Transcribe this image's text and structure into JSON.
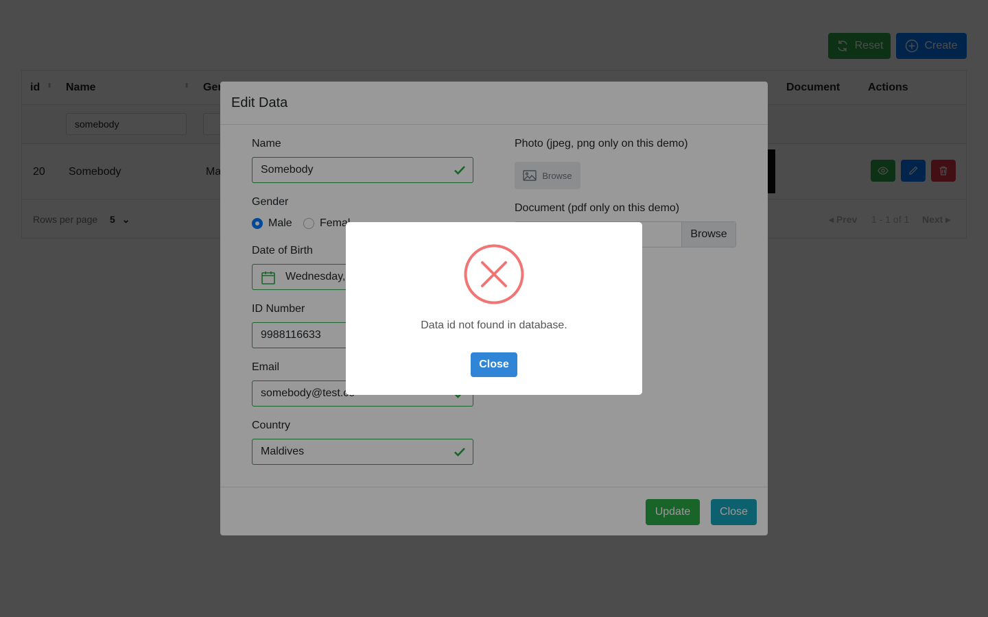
{
  "toolbar": {
    "reset_label": "Reset",
    "create_label": "Create"
  },
  "table": {
    "headers": {
      "id": "id",
      "name": "Name",
      "gender": "Gen",
      "document": "Document",
      "actions": "Actions"
    },
    "filters": {
      "name": "somebody"
    },
    "row": {
      "id": "20",
      "name": "Somebody",
      "gender": "Ma"
    },
    "footer": {
      "rows_per_page_label": "Rows per page",
      "rows_per_page_value": "5",
      "prev_label": "Prev",
      "range_label": "1 - 1 of 1",
      "next_label": "Next"
    }
  },
  "edit_modal": {
    "title": "Edit Data",
    "name_label": "Name",
    "name_value": "Somebody",
    "gender_label": "Gender",
    "gender_male": "Male",
    "gender_female": "Femal",
    "dob_label": "Date of Birth",
    "dob_value": "Wednesday,",
    "id_number_label": "ID Number",
    "id_number_value": "9988116633",
    "email_label": "Email",
    "email_value": "somebody@test.co",
    "country_label": "Country",
    "country_value": "Maldives",
    "photo_label": "Photo (jpeg, png only on this demo)",
    "photo_browse": "Browse",
    "document_label": "Document (pdf only on this demo)",
    "document_browse": "Browse",
    "update_label": "Update",
    "close_label": "Close"
  },
  "alert": {
    "message": "Data id not found in database.",
    "close_label": "Close",
    "icon": "error-x-icon",
    "accent": "#f27474"
  },
  "colors": {
    "success": "#28a745",
    "primary": "#007bff",
    "danger": "#dc3545",
    "info": "#17a2b8",
    "alert_button": "#3085d6"
  }
}
